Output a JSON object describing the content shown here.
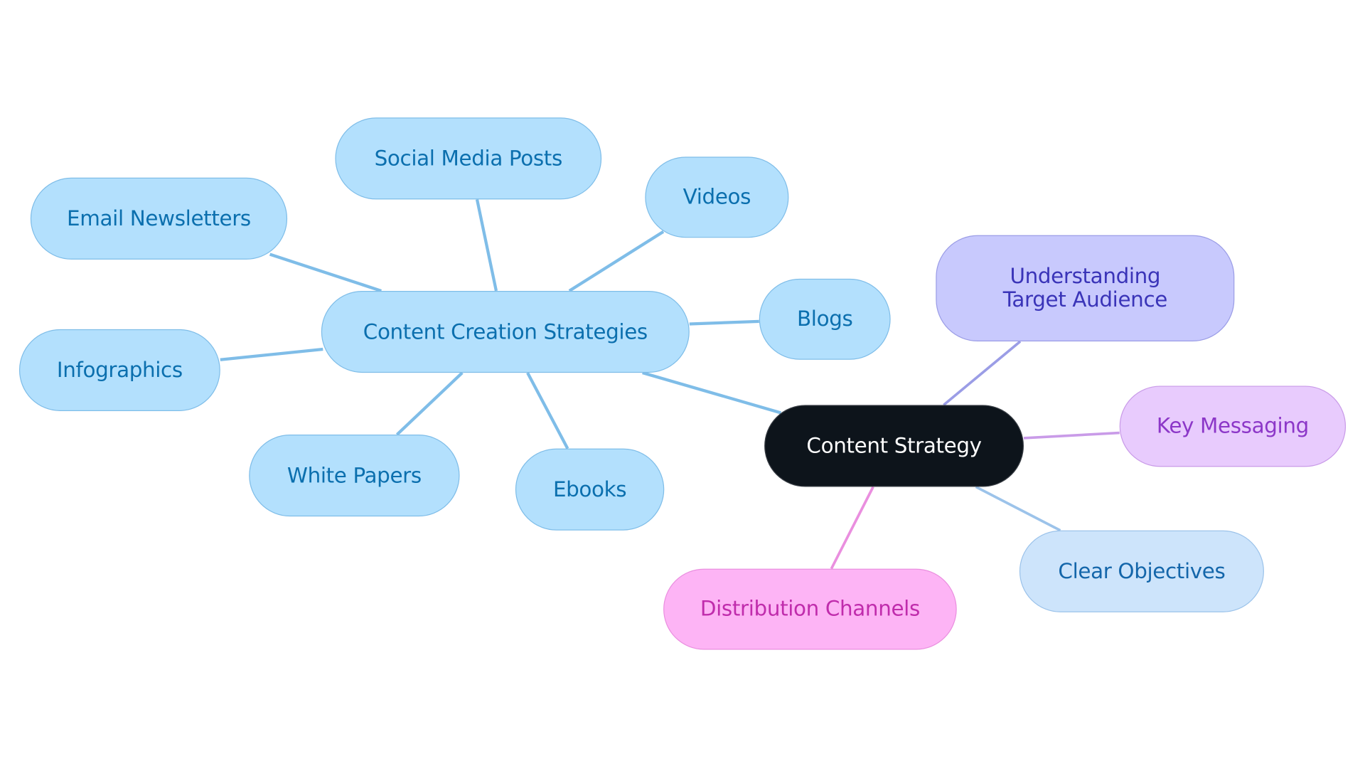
{
  "diagram": {
    "type": "mind-map",
    "root": "Content Strategy",
    "colors": {
      "blue_fill": "#b3e0fd",
      "blue_edge": "#7fbde8",
      "blue_text": "#0b6fae",
      "root_fill": "#0d141b",
      "root_text": "#ffffff",
      "purple_fill": "#c8c9fd",
      "purple_edge": "#9b9de6",
      "purple_text": "#3a34b8",
      "violet_fill": "#e8cbfd",
      "violet_edge": "#c99be8",
      "violet_text": "#8c37c8",
      "lightblue_fill": "#cde4fb",
      "lightblue_edge": "#9cc3ea",
      "lightblue_text": "#1466aa",
      "pink_fill": "#fdb4f5",
      "pink_edge": "#ea8fdf",
      "pink_text": "#c02cac"
    },
    "nodes": [
      {
        "id": "root",
        "label": "Content Strategy",
        "parent": null
      },
      {
        "id": "ccs",
        "label": "Content Creation Strategies",
        "parent": "root"
      },
      {
        "id": "uta",
        "label": "Understanding Target Audience",
        "parent": "root"
      },
      {
        "id": "km",
        "label": "Key Messaging",
        "parent": "root"
      },
      {
        "id": "co",
        "label": "Clear Objectives",
        "parent": "root"
      },
      {
        "id": "dc",
        "label": "Distribution Channels",
        "parent": "root"
      },
      {
        "id": "smp",
        "label": "Social Media Posts",
        "parent": "ccs"
      },
      {
        "id": "vid",
        "label": "Videos",
        "parent": "ccs"
      },
      {
        "id": "en",
        "label": "Email Newsletters",
        "parent": "ccs"
      },
      {
        "id": "blogs",
        "label": "Blogs",
        "parent": "ccs"
      },
      {
        "id": "info",
        "label": "Infographics",
        "parent": "ccs"
      },
      {
        "id": "wp",
        "label": "White Papers",
        "parent": "ccs"
      },
      {
        "id": "ebooks",
        "label": "Ebooks",
        "parent": "ccs"
      }
    ]
  }
}
